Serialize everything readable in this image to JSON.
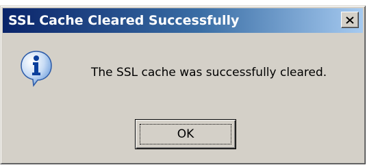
{
  "window": {
    "title": "SSL Cache Cleared Successfully",
    "close_label": "close",
    "colors": {
      "title_bar_start": "#0a246a",
      "title_bar_end": "#a6caf0",
      "face": "#d4d0c8"
    }
  },
  "body": {
    "icon": "info-icon",
    "message": "The SSL cache was successfully cleared."
  },
  "buttons": {
    "ok_label": "OK"
  }
}
